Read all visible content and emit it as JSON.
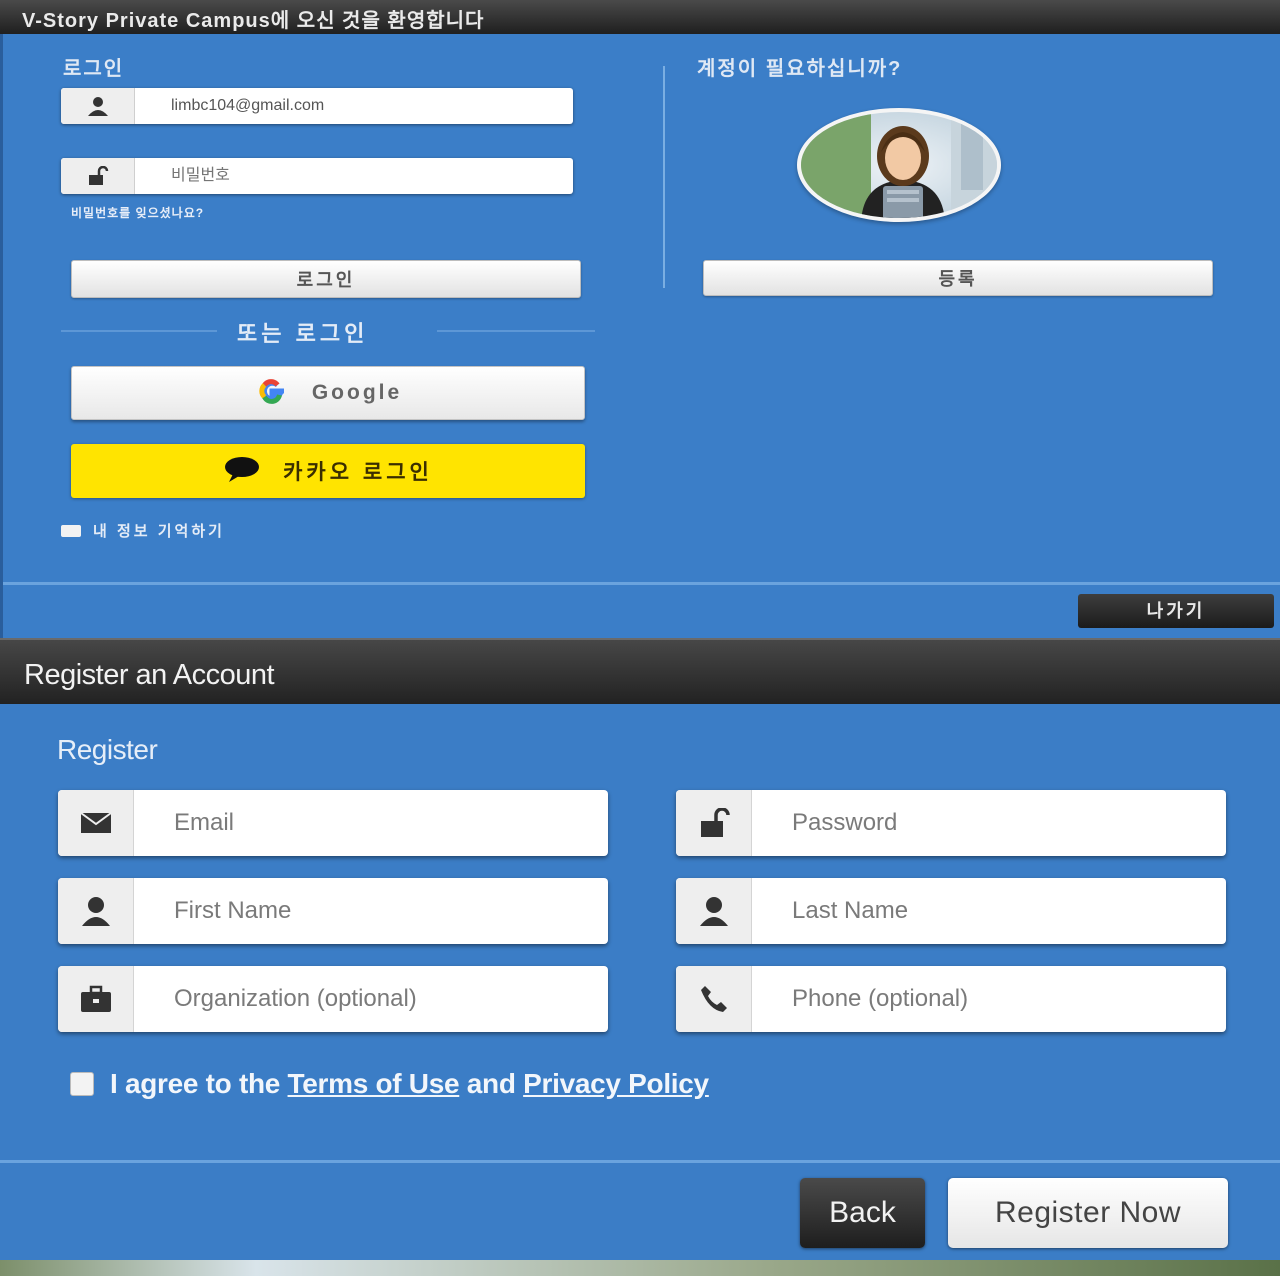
{
  "login": {
    "header_title": "V-Story Private Campus에 오신 것을 환영합니다",
    "section_label": "로그인",
    "email_value": "limbc104@gmail.com",
    "password_placeholder": "비밀번호",
    "forgot_link": "비밀번호를 잊으셨나요?",
    "login_button": "로그인",
    "or_login": "또는 로그인",
    "google_button": "Google",
    "kakao_button": "카카오 로그인",
    "remember_me": "내 정보 기억하기",
    "need_account": "계정이 필요하십니까?",
    "register_button": "등록",
    "exit_button": "나가기"
  },
  "register": {
    "header_title": "Register an Account",
    "subtitle": "Register",
    "fields": {
      "email_placeholder": "Email",
      "password_placeholder": "Password",
      "first_name_placeholder": "First Name",
      "last_name_placeholder": "Last Name",
      "organization_placeholder": "Organization (optional)",
      "phone_placeholder": "Phone (optional)"
    },
    "agree_prefix": "I agree to the",
    "terms_link": "Terms of Use",
    "agree_and": "and",
    "privacy_link": "Privacy Policy",
    "back_button": "Back",
    "register_now_button": "Register Now"
  },
  "icons": [
    "user-icon",
    "lock-icon",
    "google-icon",
    "kakao-chat-icon",
    "envelope-icon",
    "briefcase-icon",
    "phone-icon"
  ],
  "colors": {
    "panel_blue": "#3b7dc6",
    "header_dark": "#2a2a2a",
    "kakao_yellow": "#ffe400"
  }
}
